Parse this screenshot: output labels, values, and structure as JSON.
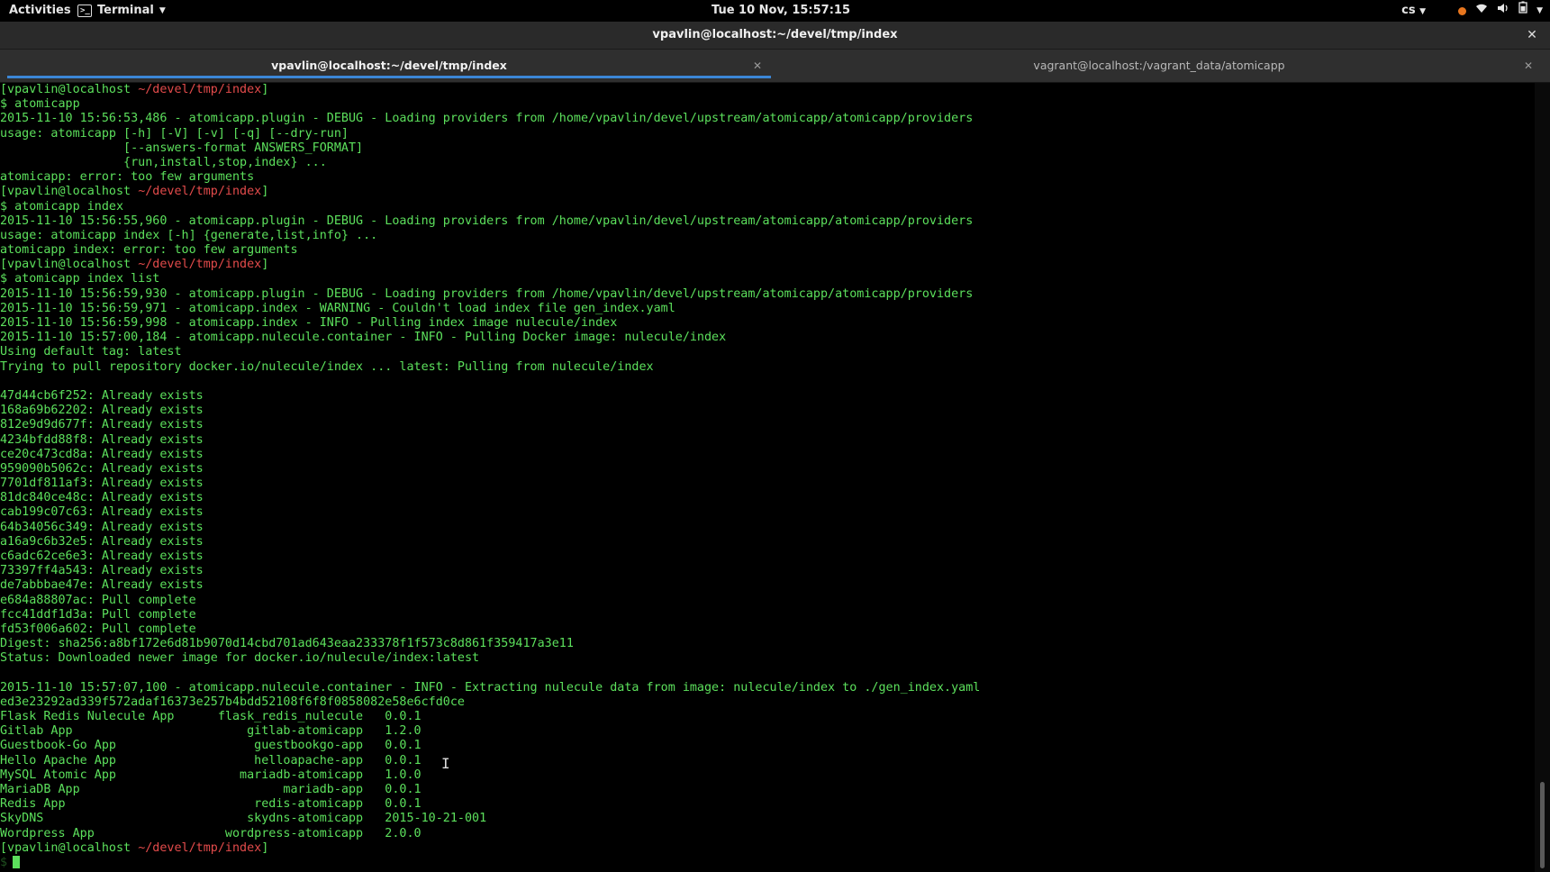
{
  "topbar": {
    "activities": "Activities",
    "app_name": "Terminal",
    "clock": "Tue 10 Nov, 15:57:15",
    "keyboard_layout": "cs",
    "status_dot_color": "#e8761e"
  },
  "window": {
    "title": "vpavlin@localhost:~/devel/tmp/index",
    "close_glyph": "✕"
  },
  "tabs": [
    {
      "label": "vpavlin@localhost:~/devel/tmp/index",
      "active": true,
      "close_glyph": "✕"
    },
    {
      "label": "vagrant@localhost:/vagrant_data/atomicapp",
      "active": false,
      "close_glyph": "✕"
    }
  ],
  "colors": {
    "terminal_green": "#5ce05c",
    "terminal_red": "#e34b4b",
    "tab_accent": "#3b86d6"
  },
  "scrollbar": {
    "visible_fraction": 0.11,
    "position": "bottom"
  },
  "terminal": {
    "prompt_dollar": "$",
    "lines": [
      [
        {
          "t": "[vpavlin@localhost ",
          "c": "g"
        },
        {
          "t": "~/devel/tmp/index",
          "c": "r"
        },
        {
          "t": "]",
          "c": "g"
        }
      ],
      [
        {
          "t": "$ atomicapp",
          "c": "g"
        }
      ],
      [
        {
          "t": "2015-11-10 15:56:53,486 - atomicapp.plugin - DEBUG - Loading providers from /home/vpavlin/devel/upstream/atomicapp/atomicapp/providers",
          "c": "g"
        }
      ],
      [
        {
          "t": "usage: atomicapp [-h] [-V] [-v] [-q] [--dry-run]",
          "c": "g"
        }
      ],
      [
        {
          "t": "                 [--answers-format ANSWERS_FORMAT]",
          "c": "g"
        }
      ],
      [
        {
          "t": "                 {run,install,stop,index} ...",
          "c": "g"
        }
      ],
      [
        {
          "t": "atomicapp: error: too few arguments",
          "c": "g"
        }
      ],
      [
        {
          "t": "[vpavlin@localhost ",
          "c": "g"
        },
        {
          "t": "~/devel/tmp/index",
          "c": "r"
        },
        {
          "t": "]",
          "c": "g"
        }
      ],
      [
        {
          "t": "$ atomicapp index",
          "c": "g"
        }
      ],
      [
        {
          "t": "2015-11-10 15:56:55,960 - atomicapp.plugin - DEBUG - Loading providers from /home/vpavlin/devel/upstream/atomicapp/atomicapp/providers",
          "c": "g"
        }
      ],
      [
        {
          "t": "usage: atomicapp index [-h] {generate,list,info} ...",
          "c": "g"
        }
      ],
      [
        {
          "t": "atomicapp index: error: too few arguments",
          "c": "g"
        }
      ],
      [
        {
          "t": "[vpavlin@localhost ",
          "c": "g"
        },
        {
          "t": "~/devel/tmp/index",
          "c": "r"
        },
        {
          "t": "]",
          "c": "g"
        }
      ],
      [
        {
          "t": "$ atomicapp index list",
          "c": "g"
        }
      ],
      [
        {
          "t": "2015-11-10 15:56:59,930 - atomicapp.plugin - DEBUG - Loading providers from /home/vpavlin/devel/upstream/atomicapp/atomicapp/providers",
          "c": "g"
        }
      ],
      [
        {
          "t": "2015-11-10 15:56:59,971 - atomicapp.index - WARNING - Couldn't load index file gen_index.yaml",
          "c": "g"
        }
      ],
      [
        {
          "t": "2015-11-10 15:56:59,998 - atomicapp.index - INFO - Pulling index image nulecule/index",
          "c": "g"
        }
      ],
      [
        {
          "t": "2015-11-10 15:57:00,184 - atomicapp.nulecule.container - INFO - Pulling Docker image: nulecule/index",
          "c": "g"
        }
      ],
      [
        {
          "t": "Using default tag: latest",
          "c": "g"
        }
      ],
      [
        {
          "t": "Trying to pull repository docker.io/nulecule/index ... latest: Pulling from nulecule/index",
          "c": "g"
        }
      ],
      [
        {
          "t": "",
          "c": "g"
        }
      ],
      [
        {
          "t": "47d44cb6f252: Already exists",
          "c": "g"
        }
      ],
      [
        {
          "t": "168a69b62202: Already exists",
          "c": "g"
        }
      ],
      [
        {
          "t": "812e9d9d677f: Already exists",
          "c": "g"
        }
      ],
      [
        {
          "t": "4234bfdd88f8: Already exists",
          "c": "g"
        }
      ],
      [
        {
          "t": "ce20c473cd8a: Already exists",
          "c": "g"
        }
      ],
      [
        {
          "t": "959090b5062c: Already exists",
          "c": "g"
        }
      ],
      [
        {
          "t": "7701df811af3: Already exists",
          "c": "g"
        }
      ],
      [
        {
          "t": "81dc840ce48c: Already exists",
          "c": "g"
        }
      ],
      [
        {
          "t": "cab199c07c63: Already exists",
          "c": "g"
        }
      ],
      [
        {
          "t": "64b34056c349: Already exists",
          "c": "g"
        }
      ],
      [
        {
          "t": "a16a9c6b32e5: Already exists",
          "c": "g"
        }
      ],
      [
        {
          "t": "c6adc62ce6e3: Already exists",
          "c": "g"
        }
      ],
      [
        {
          "t": "73397ff4a543: Already exists",
          "c": "g"
        }
      ],
      [
        {
          "t": "de7abbbae47e: Already exists",
          "c": "g"
        }
      ],
      [
        {
          "t": "e684a88807ac: Pull complete",
          "c": "g"
        }
      ],
      [
        {
          "t": "fcc41ddf1d3a: Pull complete",
          "c": "g"
        }
      ],
      [
        {
          "t": "fd53f006a602: Pull complete",
          "c": "g"
        }
      ],
      [
        {
          "t": "Digest: sha256:a8bf172e6d81b9070d14cbd701ad643eaa233378f1f573c8d861f359417a3e11",
          "c": "g"
        }
      ],
      [
        {
          "t": "Status: Downloaded newer image for docker.io/nulecule/index:latest",
          "c": "g"
        }
      ],
      [
        {
          "t": "",
          "c": "g"
        }
      ],
      [
        {
          "t": "2015-11-10 15:57:07,100 - atomicapp.nulecule.container - INFO - Extracting nulecule data from image: nulecule/index to ./gen_index.yaml",
          "c": "g"
        }
      ],
      [
        {
          "t": "ed3e23292ad339f572adaf16373e257b4bdd52108f6f8f0858082e58e6cfd0ce",
          "c": "g"
        }
      ],
      [
        {
          "t": "Flask Redis Nulecule App      flask_redis_nulecule   0.0.1",
          "c": "g"
        }
      ],
      [
        {
          "t": "Gitlab App                        gitlab-atomicapp   1.2.0",
          "c": "g"
        }
      ],
      [
        {
          "t": "Guestbook-Go App                   guestbookgo-app   0.0.1",
          "c": "g"
        }
      ],
      [
        {
          "t": "Hello Apache App                   helloapache-app   0.0.1",
          "c": "g"
        }
      ],
      [
        {
          "t": "MySQL Atomic App                 mariadb-atomicapp   1.0.0",
          "c": "g"
        }
      ],
      [
        {
          "t": "MariaDB App                            mariadb-app   0.0.1",
          "c": "g"
        }
      ],
      [
        {
          "t": "Redis App                          redis-atomicapp   0.0.1",
          "c": "g"
        }
      ],
      [
        {
          "t": "SkyDNS                            skydns-atomicapp   2015-10-21-001",
          "c": "g"
        }
      ],
      [
        {
          "t": "Wordpress App                  wordpress-atomicapp   2.0.0",
          "c": "g"
        }
      ],
      [
        {
          "t": "[vpavlin@localhost ",
          "c": "g"
        },
        {
          "t": "~/devel/tmp/index",
          "c": "r"
        },
        {
          "t": "]",
          "c": "g"
        }
      ]
    ]
  }
}
